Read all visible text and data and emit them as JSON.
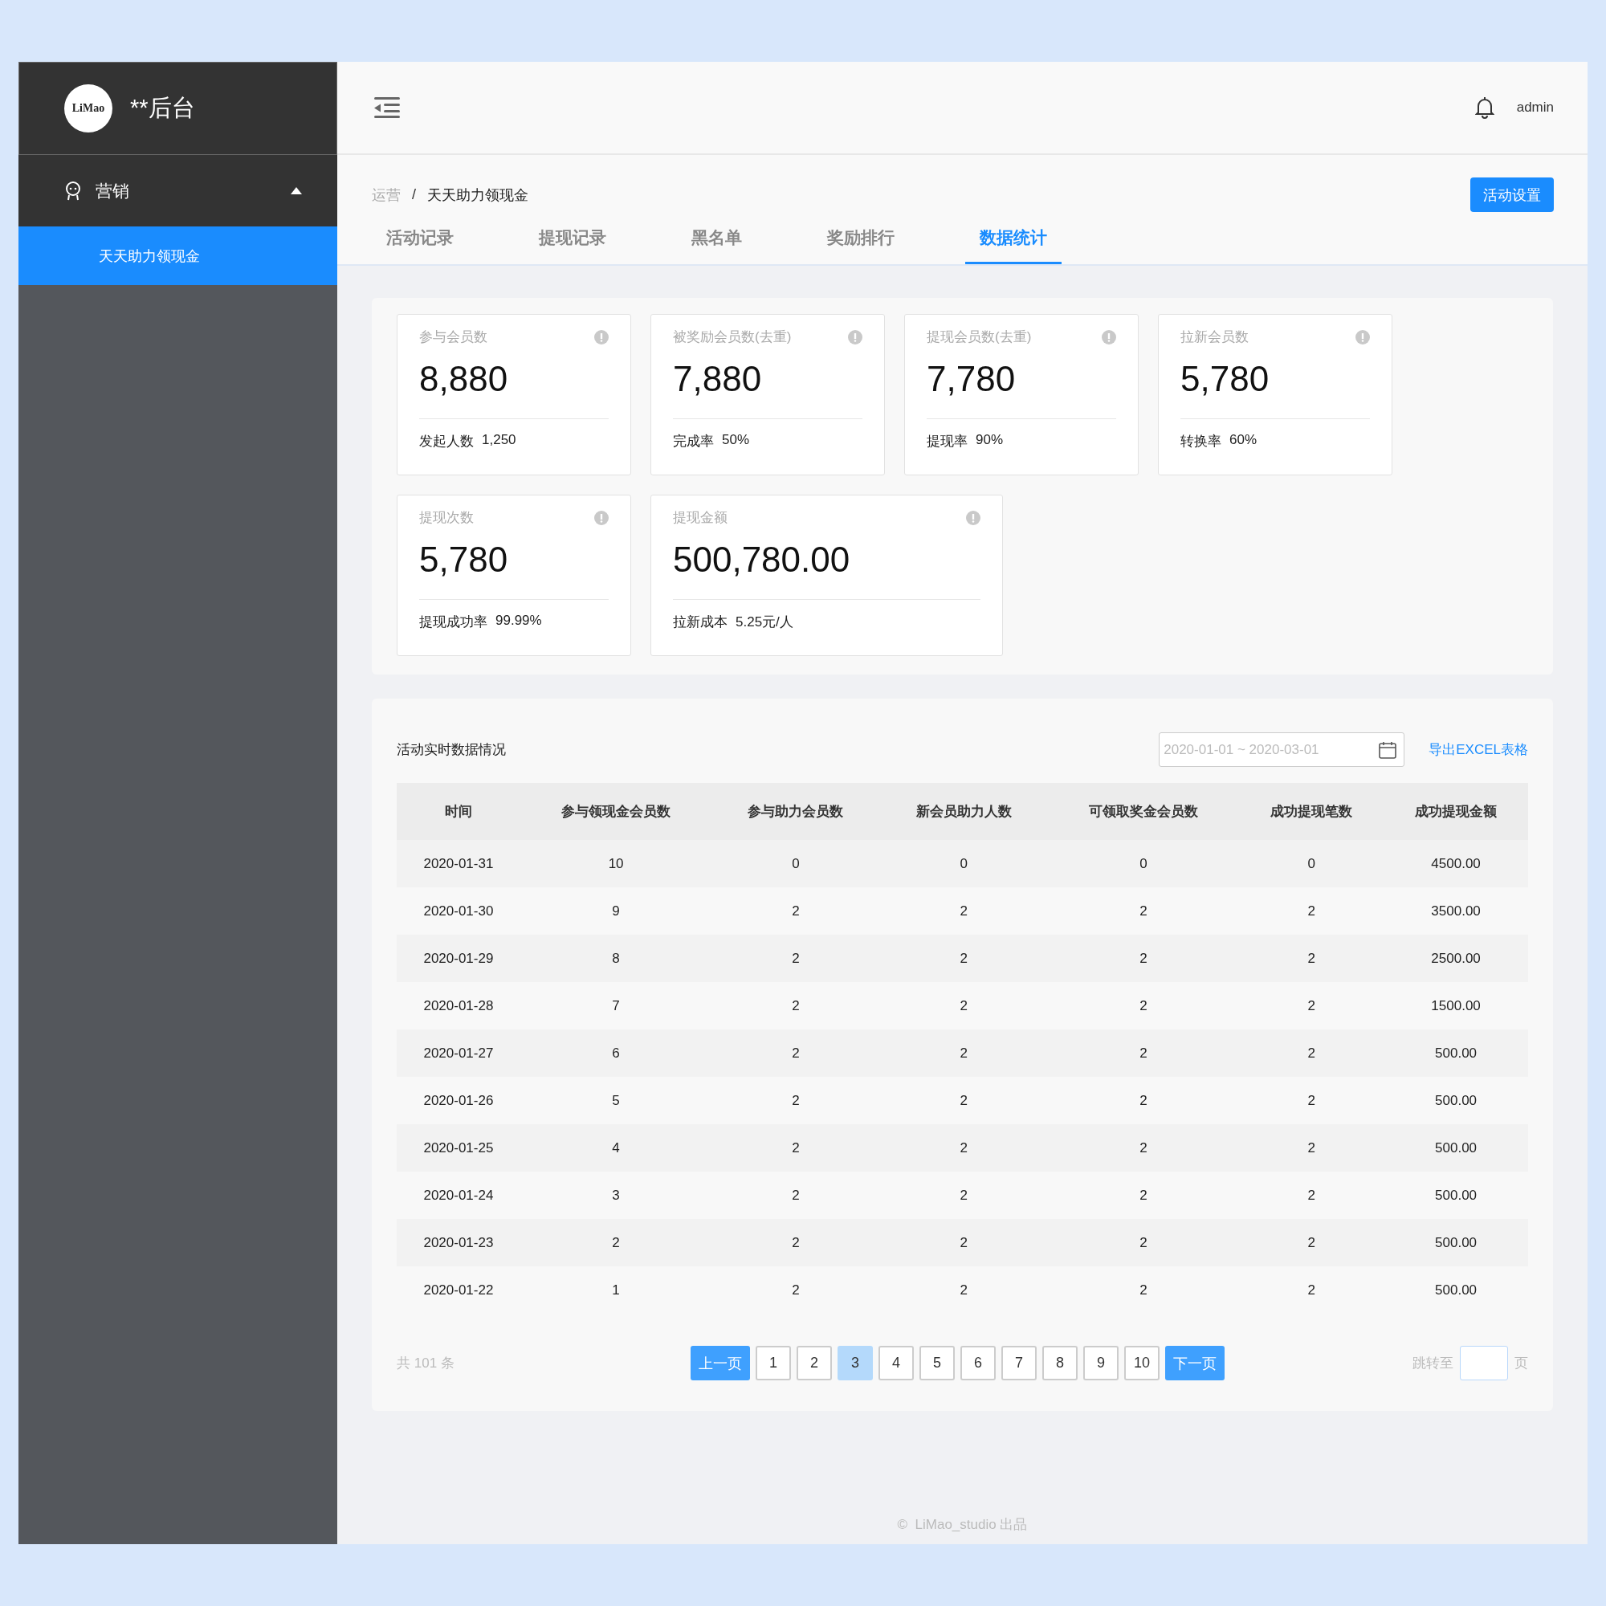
{
  "sidebar": {
    "logo_text": "LiMao",
    "title": "**后台",
    "menu": [
      {
        "label": "营销",
        "expanded": true,
        "children": [
          {
            "label": "天天助力领现金",
            "selected": true
          }
        ]
      }
    ]
  },
  "topbar": {
    "user": "admin"
  },
  "breadcrumb": {
    "separator": "/",
    "items": [
      "运营",
      "天天助力领现金"
    ]
  },
  "action_button": "活动设置",
  "tabs": [
    {
      "label": "活动记录",
      "selected": false
    },
    {
      "label": "提现记录",
      "selected": false
    },
    {
      "label": "黑名单",
      "selected": false
    },
    {
      "label": "奖励排行",
      "selected": false
    },
    {
      "label": "数据统计",
      "selected": true
    }
  ],
  "stats": [
    {
      "title": "参与会员数",
      "value": "8,880",
      "footer_label": "发起人数",
      "footer_value": "1,250"
    },
    {
      "title": "被奖励会员数(去重)",
      "value": "7,880",
      "footer_label": "完成率",
      "footer_value": "50%"
    },
    {
      "title": "提现会员数(去重)",
      "value": "7,780",
      "footer_label": "提现率",
      "footer_value": "90%"
    },
    {
      "title": "拉新会员数",
      "value": "5,780",
      "footer_label": "转换率",
      "footer_value": "60%"
    },
    {
      "title": "提现次数",
      "value": "5,780",
      "footer_label": "提现成功率",
      "footer_value": "99.99%"
    },
    {
      "title": "提现金额",
      "value": "500,780.00",
      "footer_label": "拉新成本",
      "footer_value": "5.25元/人"
    }
  ],
  "table": {
    "title": "活动实时数据情况",
    "date_range": {
      "placeholder": "2020-01-01 ~ 2020-03-01"
    },
    "export_link": "导出EXCEL表格",
    "columns": [
      "时间",
      "参与领现金会员数",
      "参与助力会员数",
      "新会员助力人数",
      "可领取奖金会员数",
      "成功提现笔数",
      "成功提现金额"
    ],
    "rows": [
      [
        "2020-01-31",
        "10",
        "0",
        "0",
        "0",
        "0",
        "4500.00"
      ],
      [
        "2020-01-30",
        "9",
        "2",
        "2",
        "2",
        "2",
        "3500.00"
      ],
      [
        "2020-01-29",
        "8",
        "2",
        "2",
        "2",
        "2",
        "2500.00"
      ],
      [
        "2020-01-28",
        "7",
        "2",
        "2",
        "2",
        "2",
        "1500.00"
      ],
      [
        "2020-01-27",
        "6",
        "2",
        "2",
        "2",
        "2",
        "500.00"
      ],
      [
        "2020-01-26",
        "5",
        "2",
        "2",
        "2",
        "2",
        "500.00"
      ],
      [
        "2020-01-25",
        "4",
        "2",
        "2",
        "2",
        "2",
        "500.00"
      ],
      [
        "2020-01-24",
        "3",
        "2",
        "2",
        "2",
        "2",
        "500.00"
      ],
      [
        "2020-01-23",
        "2",
        "2",
        "2",
        "2",
        "2",
        "500.00"
      ],
      [
        "2020-01-22",
        "1",
        "2",
        "2",
        "2",
        "2",
        "500.00"
      ]
    ]
  },
  "pagination": {
    "total": "共 101 条",
    "prev": "上一页",
    "pages": [
      {
        "label": "1",
        "selected": false
      },
      {
        "label": "2",
        "selected": false
      },
      {
        "label": "3",
        "selected": true
      },
      {
        "label": "4",
        "selected": false
      },
      {
        "label": "5",
        "selected": false
      },
      {
        "label": "6",
        "selected": false
      },
      {
        "label": "7",
        "selected": false
      },
      {
        "label": "8",
        "selected": false
      },
      {
        "label": "9",
        "selected": false
      },
      {
        "label": "10",
        "selected": false
      }
    ],
    "next": "下一页",
    "jump_label": "跳转至",
    "jump_suffix": "页"
  },
  "footer": "©  LiMao_studio 出品"
}
